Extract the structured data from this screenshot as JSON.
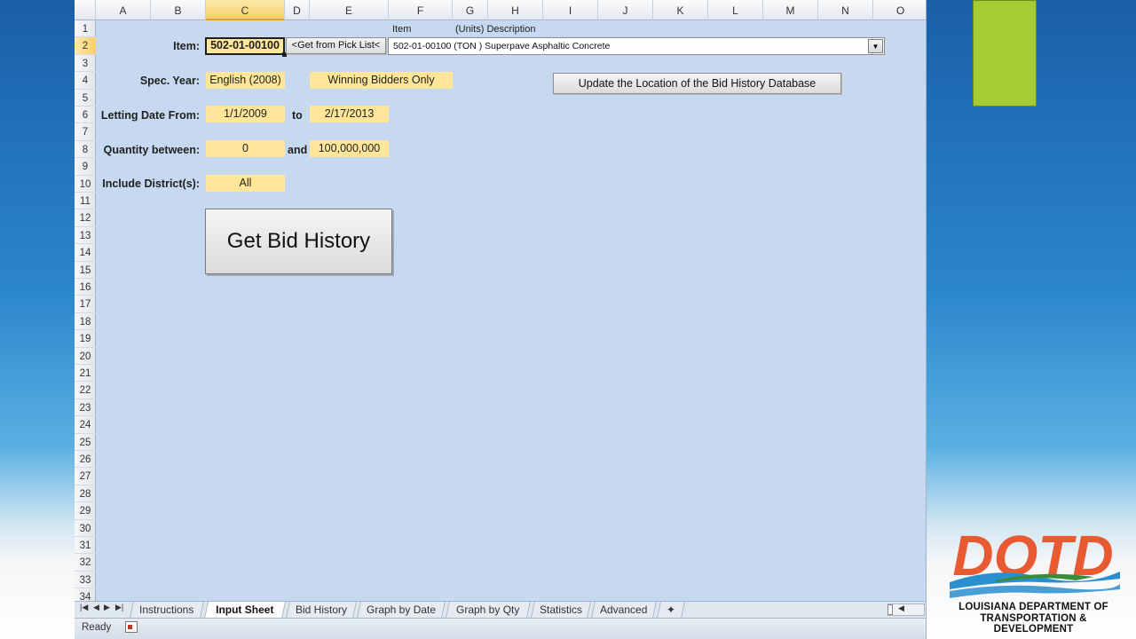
{
  "columns": [
    "A",
    "B",
    "C",
    "D",
    "E",
    "F",
    "G",
    "H",
    "I",
    "J",
    "K",
    "L",
    "M",
    "N",
    "O"
  ],
  "selected_column": "C",
  "rows": [
    "1",
    "2",
    "3",
    "4",
    "5",
    "6",
    "7",
    "8",
    "9",
    "10",
    "11",
    "12",
    "13",
    "14",
    "15",
    "16",
    "17",
    "18",
    "19",
    "20",
    "21",
    "22",
    "23",
    "24",
    "25",
    "26",
    "27",
    "28",
    "29",
    "30",
    "31",
    "32",
    "33",
    "34"
  ],
  "selected_row": "2",
  "form": {
    "item_label": "Item:",
    "item_value": "502-01-00100",
    "pick_list_button": "<Get from Pick List<",
    "item_col_header": "Item",
    "units_desc_header": "(Units)  Description",
    "item_combo_value": "502-01-00100 (TON ) Superpave Asphaltic Concrete",
    "spec_year_label": "Spec. Year:",
    "spec_year_value": "English (2008)",
    "winning_bidders_value": "Winning Bidders Only",
    "update_location_button": "Update the Location of the Bid History Database",
    "letting_date_label": "Letting Date From:",
    "letting_from": "1/1/2009",
    "to_label": "to",
    "letting_to": "2/17/2013",
    "quantity_label": "Quantity between:",
    "quantity_min": "0",
    "and_label": "and",
    "quantity_max": "100,000,000",
    "district_label": "Include District(s):",
    "district_value": "All",
    "get_bid_history_button": "Get Bid History"
  },
  "sheet_tabs": [
    "Instructions",
    "Input Sheet",
    "Bid History",
    "Graph by Date",
    "Graph by Qty",
    "Statistics",
    "Advanced"
  ],
  "active_tab": "Input Sheet",
  "status": {
    "ready": "Ready"
  },
  "logo": {
    "letters": "DOTD",
    "line1": "LOUISIANA DEPARTMENT OF",
    "line2": "TRANSPORTATION & DEVELOPMENT"
  },
  "colors": {
    "sheet_bg": "#c6d9f0",
    "input_cell": "#ffe699",
    "accent_green": "#a6cc35",
    "logo_orange": "#e85a32",
    "logo_blue": "#2a8fcf"
  }
}
